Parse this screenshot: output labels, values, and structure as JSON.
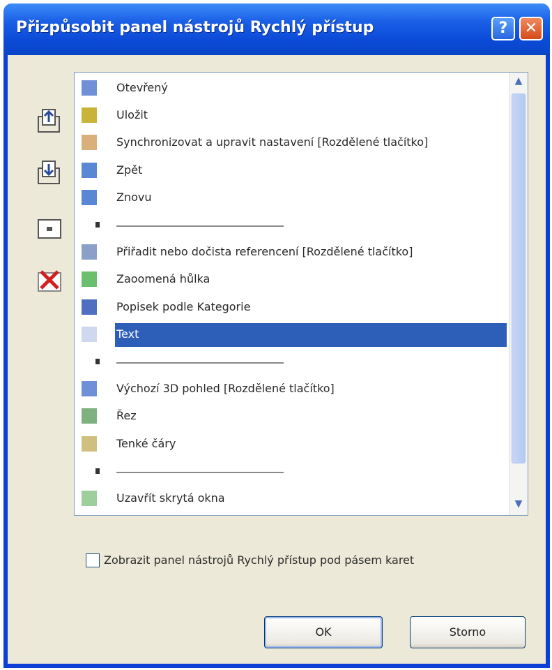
{
  "window": {
    "title": "Přizpůsobit panel nástrojů Rychlý přístup",
    "help_glyph": "?",
    "close_glyph": "✕"
  },
  "side_buttons": [
    {
      "name": "move-up",
      "icon": "move-up-icon"
    },
    {
      "name": "move-down",
      "icon": "move-down-icon"
    },
    {
      "name": "reset",
      "icon": "reset-icon"
    },
    {
      "name": "delete",
      "icon": "delete-icon"
    }
  ],
  "list": {
    "items": [
      {
        "label": "Otevřený",
        "type": "item",
        "icon_color": "#6f8fd8"
      },
      {
        "label": "Uložit",
        "type": "item",
        "icon_color": "#c9b43a"
      },
      {
        "label": "Synchronizovat a upravit nastavení [Rozdělené tlačítko]",
        "type": "item",
        "icon_color": "#d9b07a"
      },
      {
        "label": "Zpět",
        "type": "item",
        "icon_color": "#5a86d6"
      },
      {
        "label": "Znovu",
        "type": "item",
        "icon_color": "#5a86d6"
      },
      {
        "label": "",
        "type": "separator"
      },
      {
        "label": "Přiřadit nebo dočista referencení [Rozdělené tlačítko]",
        "type": "item",
        "icon_color": "#8aa0c8"
      },
      {
        "label": "Zaoomená hůlka",
        "type": "item",
        "icon_color": "#6cbf6c"
      },
      {
        "label": "Popisek podle Kategorie",
        "type": "item",
        "icon_color": "#4f6fc0"
      },
      {
        "label": "Text",
        "type": "item",
        "icon_color": "#d0d8f0",
        "selected": true
      },
      {
        "label": "",
        "type": "separator"
      },
      {
        "label": "Výchozí 3D pohled [Rozdělené tlačítko]",
        "type": "item",
        "icon_color": "#6f8fd8"
      },
      {
        "label": "Řez",
        "type": "item",
        "icon_color": "#7fb07f"
      },
      {
        "label": "Tenké čáry",
        "type": "item",
        "icon_color": "#d0c080"
      },
      {
        "label": "",
        "type": "separator"
      },
      {
        "label": "Uzavřít skrytá okna",
        "type": "item",
        "icon_color": "#9ccf9c"
      }
    ],
    "scroll_up": "▲",
    "scroll_down": "▼"
  },
  "option": {
    "label": "Zobrazit panel nástrojů Rychlý přístup pod pásem karet",
    "checked": false
  },
  "buttons": {
    "ok": "OK",
    "cancel": "Storno"
  }
}
